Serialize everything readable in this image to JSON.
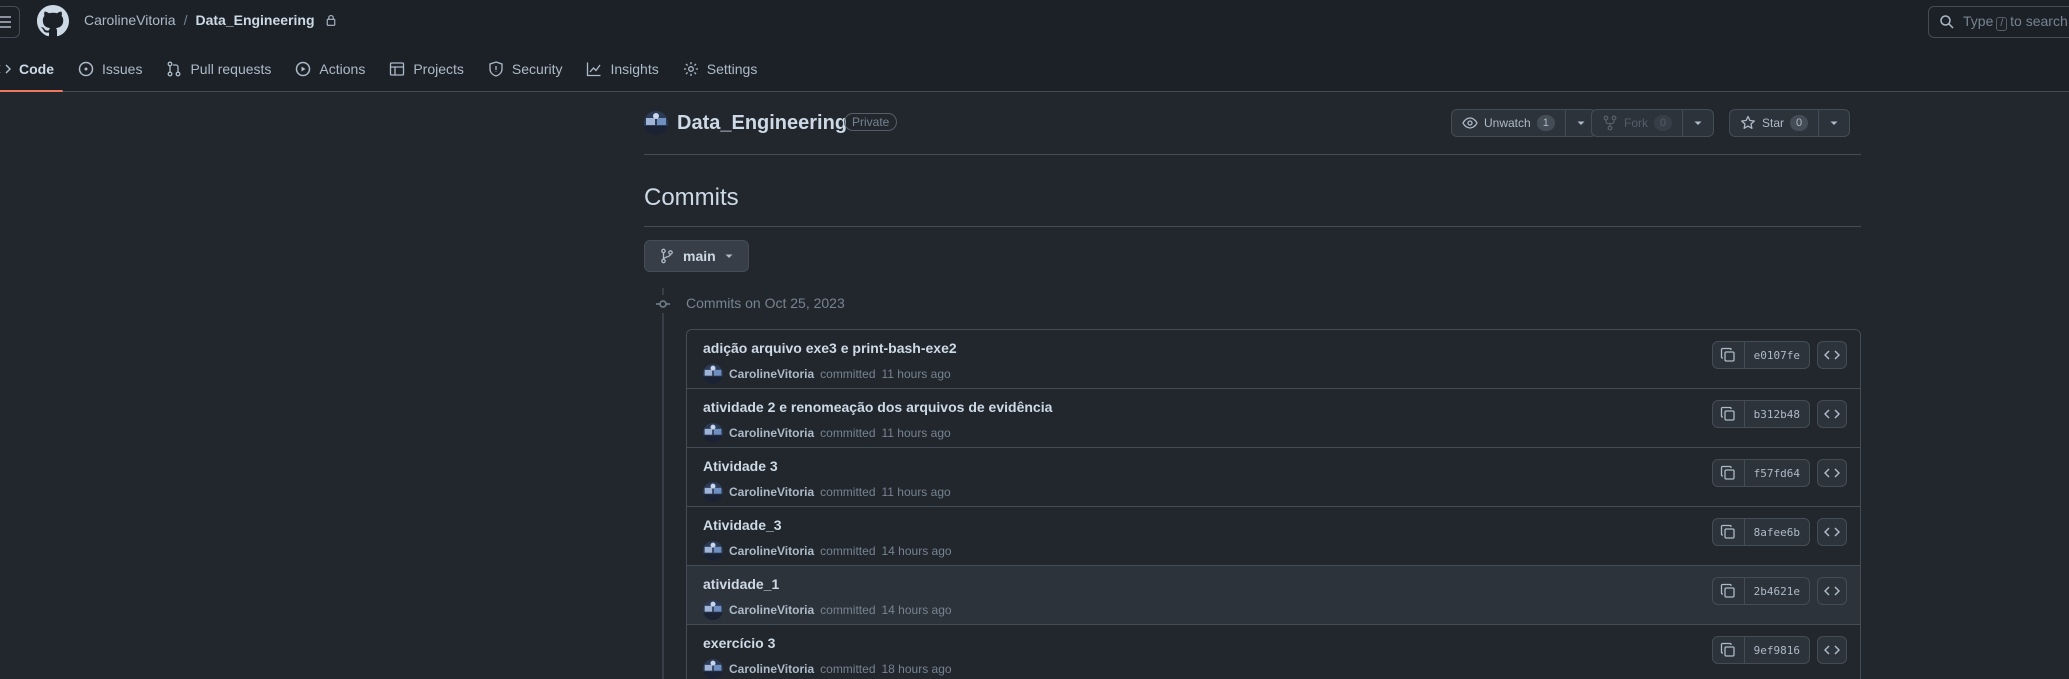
{
  "header": {
    "owner": "CarolineVitoria",
    "separator": "/",
    "repo": "Data_Engineering",
    "search_prefix": "Type",
    "search_key": "/",
    "search_suffix": "to search"
  },
  "tabs": [
    {
      "label": "Code",
      "icon": "code-icon",
      "active": true
    },
    {
      "label": "Issues",
      "icon": "issue-icon"
    },
    {
      "label": "Pull requests",
      "icon": "pull-request-icon"
    },
    {
      "label": "Actions",
      "icon": "play-icon"
    },
    {
      "label": "Projects",
      "icon": "table-icon"
    },
    {
      "label": "Security",
      "icon": "shield-icon"
    },
    {
      "label": "Insights",
      "icon": "graph-icon"
    },
    {
      "label": "Settings",
      "icon": "gear-icon"
    }
  ],
  "repo": {
    "title": "Data_Engineering",
    "visibility": "Private",
    "unwatch_label": "Unwatch",
    "unwatch_count": "1",
    "fork_label": "Fork",
    "fork_count": "0",
    "star_label": "Star",
    "star_count": "0"
  },
  "page": {
    "heading": "Commits",
    "branch": "main",
    "commit_date": "Commits on Oct 25, 2023"
  },
  "commits": [
    {
      "message": "adição arquivo exe3 e print-bash-exe2",
      "author": "CarolineVitoria",
      "action": "committed",
      "time": "11 hours ago",
      "sha": "e0107fe"
    },
    {
      "message": "atividade 2 e renomeação dos arquivos de evidência",
      "author": "CarolineVitoria",
      "action": "committed",
      "time": "11 hours ago",
      "sha": "b312b48"
    },
    {
      "message": "Atividade 3",
      "author": "CarolineVitoria",
      "action": "committed",
      "time": "11 hours ago",
      "sha": "f57fd64"
    },
    {
      "message": "Atividade_3",
      "author": "CarolineVitoria",
      "action": "committed",
      "time": "14 hours ago",
      "sha": "8afee6b"
    },
    {
      "message": "atividade_1",
      "author": "CarolineVitoria",
      "action": "committed",
      "time": "14 hours ago",
      "sha": "2b4621e"
    },
    {
      "message": "exercício 3",
      "author": "CarolineVitoria",
      "action": "committed",
      "time": "18 hours ago",
      "sha": "9ef9816"
    }
  ]
}
